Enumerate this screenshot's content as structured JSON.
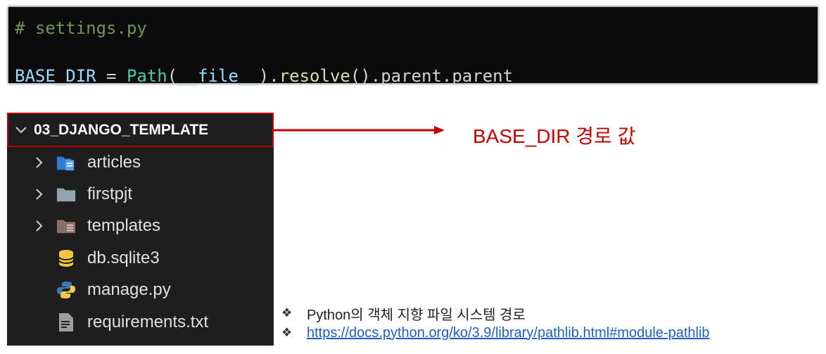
{
  "code": {
    "line1": "# settings.py",
    "line2": {
      "var": "BASE_DIR",
      "op": " = ",
      "cls": "Path",
      "p1": "(",
      "arg": "__file__",
      "p2": ").",
      "fn": "resolve",
      "rest": "().parent.parent"
    }
  },
  "explorer": {
    "root": {
      "label": "03_DJANGO_TEMPLATE",
      "icon": "chevron-down-icon"
    },
    "items": [
      {
        "label": "articles",
        "icon": "folder-doc-icon",
        "has_chevron": true
      },
      {
        "label": "firstpjt",
        "icon": "folder-icon",
        "has_chevron": true
      },
      {
        "label": "templates",
        "icon": "folder-template-icon",
        "has_chevron": true
      },
      {
        "label": "db.sqlite3",
        "icon": "database-icon",
        "has_chevron": false
      },
      {
        "label": "manage.py",
        "icon": "python-icon",
        "has_chevron": false
      },
      {
        "label": "requirements.txt",
        "icon": "text-file-icon",
        "has_chevron": false
      }
    ]
  },
  "annotation": {
    "label": "BASE_DIR 경로 값",
    "color": "#c00000"
  },
  "notes": {
    "bullet": "❖",
    "line1": "Python의 객체 지향 파일 시스템 경로",
    "line2": "https://docs.python.org/ko/3.9/library/pathlib.html#module-pathlib"
  }
}
